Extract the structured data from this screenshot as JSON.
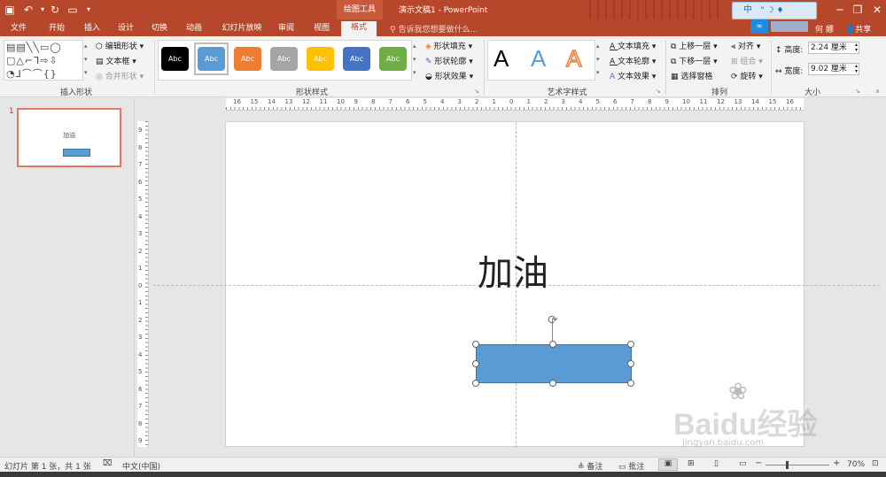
{
  "window": {
    "title": "演示文稿1 - PowerPoint",
    "context_tab_group": "绘图工具",
    "user": "何 娜",
    "share": "共享",
    "tell_me": "告诉我您想要做什么..."
  },
  "tabs": [
    "文件",
    "开始",
    "插入",
    "设计",
    "切换",
    "动画",
    "幻灯片放映",
    "审阅",
    "视图",
    "格式"
  ],
  "ribbon": {
    "insert_shapes": {
      "label": "插入形状",
      "edit_shape": "编辑形状",
      "text_box": "文本框",
      "merge_shapes": "合并形状"
    },
    "shape_styles": {
      "label": "形状样式",
      "styles": [
        {
          "text": "Abc",
          "color": "#000000"
        },
        {
          "text": "Abc",
          "color": "#5b9bd5"
        },
        {
          "text": "Abc",
          "color": "#ed7d31"
        },
        {
          "text": "Abc",
          "color": "#a5a5a5"
        },
        {
          "text": "Abc",
          "color": "#ffc000"
        },
        {
          "text": "Abc",
          "color": "#4472c4"
        },
        {
          "text": "Abc",
          "color": "#70ad47"
        }
      ],
      "fill": "形状填充",
      "outline": "形状轮廓",
      "effects": "形状效果"
    },
    "wordart": {
      "label": "艺术字样式",
      "letters": [
        "A",
        "A",
        "A"
      ],
      "text_fill": "文本填充",
      "text_outline": "文本轮廓",
      "text_effects": "文本效果"
    },
    "arrange": {
      "label": "排列",
      "bring_forward": "上移一层",
      "send_backward": "下移一层",
      "selection_pane": "选择窗格",
      "align": "对齐",
      "group": "组合",
      "rotate": "旋转"
    },
    "size": {
      "label": "大小",
      "height_label": "高度:",
      "height_value": "2.24 厘米",
      "width_label": "宽度:",
      "width_value": "9.02 厘米"
    }
  },
  "thumbnail": {
    "number": "1",
    "text": "加油"
  },
  "slide": {
    "text": "加油"
  },
  "hruler_labels": [
    "16",
    "15",
    "14",
    "13",
    "12",
    "11",
    "10",
    "9",
    "8",
    "7",
    "6",
    "5",
    "4",
    "3",
    "2",
    "1",
    "0",
    "1",
    "2",
    "3",
    "4",
    "5",
    "6",
    "7",
    "8",
    "9",
    "10",
    "11",
    "12",
    "13",
    "14",
    "15",
    "16"
  ],
  "vruler_labels": [
    "9",
    "8",
    "7",
    "6",
    "5",
    "4",
    "3",
    "2",
    "1",
    "0",
    "1",
    "2",
    "3",
    "4",
    "5",
    "6",
    "7",
    "8",
    "9"
  ],
  "status": {
    "slide_info": "幻灯片 第 1 张，共 1 张",
    "language": "中文(中国)",
    "notes": "备注",
    "comments": "批注",
    "zoom": "70%"
  },
  "ime": {
    "label": "中"
  },
  "watermark": {
    "brand": "Baidu经验",
    "url": "jingyan.baidu.com"
  },
  "colors": {
    "accent": "#b7472a",
    "shape_fill": "#5b9bd5",
    "shape_border": "#41719c"
  }
}
